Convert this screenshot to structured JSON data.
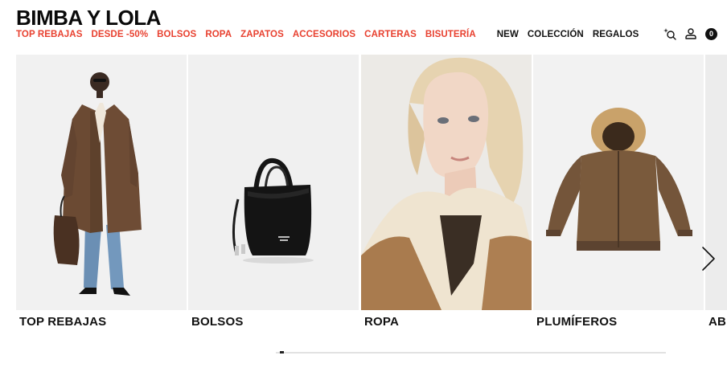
{
  "brand": {
    "name": "BIMBA Y LOLA"
  },
  "nav": {
    "promo_items": [
      {
        "label": "TOP REBAJAS"
      },
      {
        "label": "DESDE -50%"
      },
      {
        "label": "BOLSOS"
      },
      {
        "label": "ROPA"
      },
      {
        "label": "ZAPATOS"
      },
      {
        "label": "ACCESORIOS"
      },
      {
        "label": "CARTERAS"
      },
      {
        "label": "BISUTERÍA"
      }
    ],
    "main_items": [
      {
        "label": "NEW"
      },
      {
        "label": "COLECCIÓN"
      },
      {
        "label": "REGALOS"
      }
    ],
    "promo_color": "#e8402f"
  },
  "header_icons": {
    "search": "search-sparkle-icon",
    "account": "user-icon",
    "cart_count": "0"
  },
  "carousel": {
    "cards": [
      {
        "caption": "TOP REBAJAS",
        "image": "model-in-brown-coat"
      },
      {
        "caption": "BOLSOS",
        "image": "black-leather-bag"
      },
      {
        "caption": "ROPA",
        "image": "model-in-shearling-jacket"
      },
      {
        "caption": "PLUMÍFEROS",
        "image": "brown-hooded-bomber"
      },
      {
        "caption": "AB",
        "image": "partial-card"
      }
    ],
    "next_icon": "chevron-right-icon",
    "scroll_progress": 0.01
  }
}
